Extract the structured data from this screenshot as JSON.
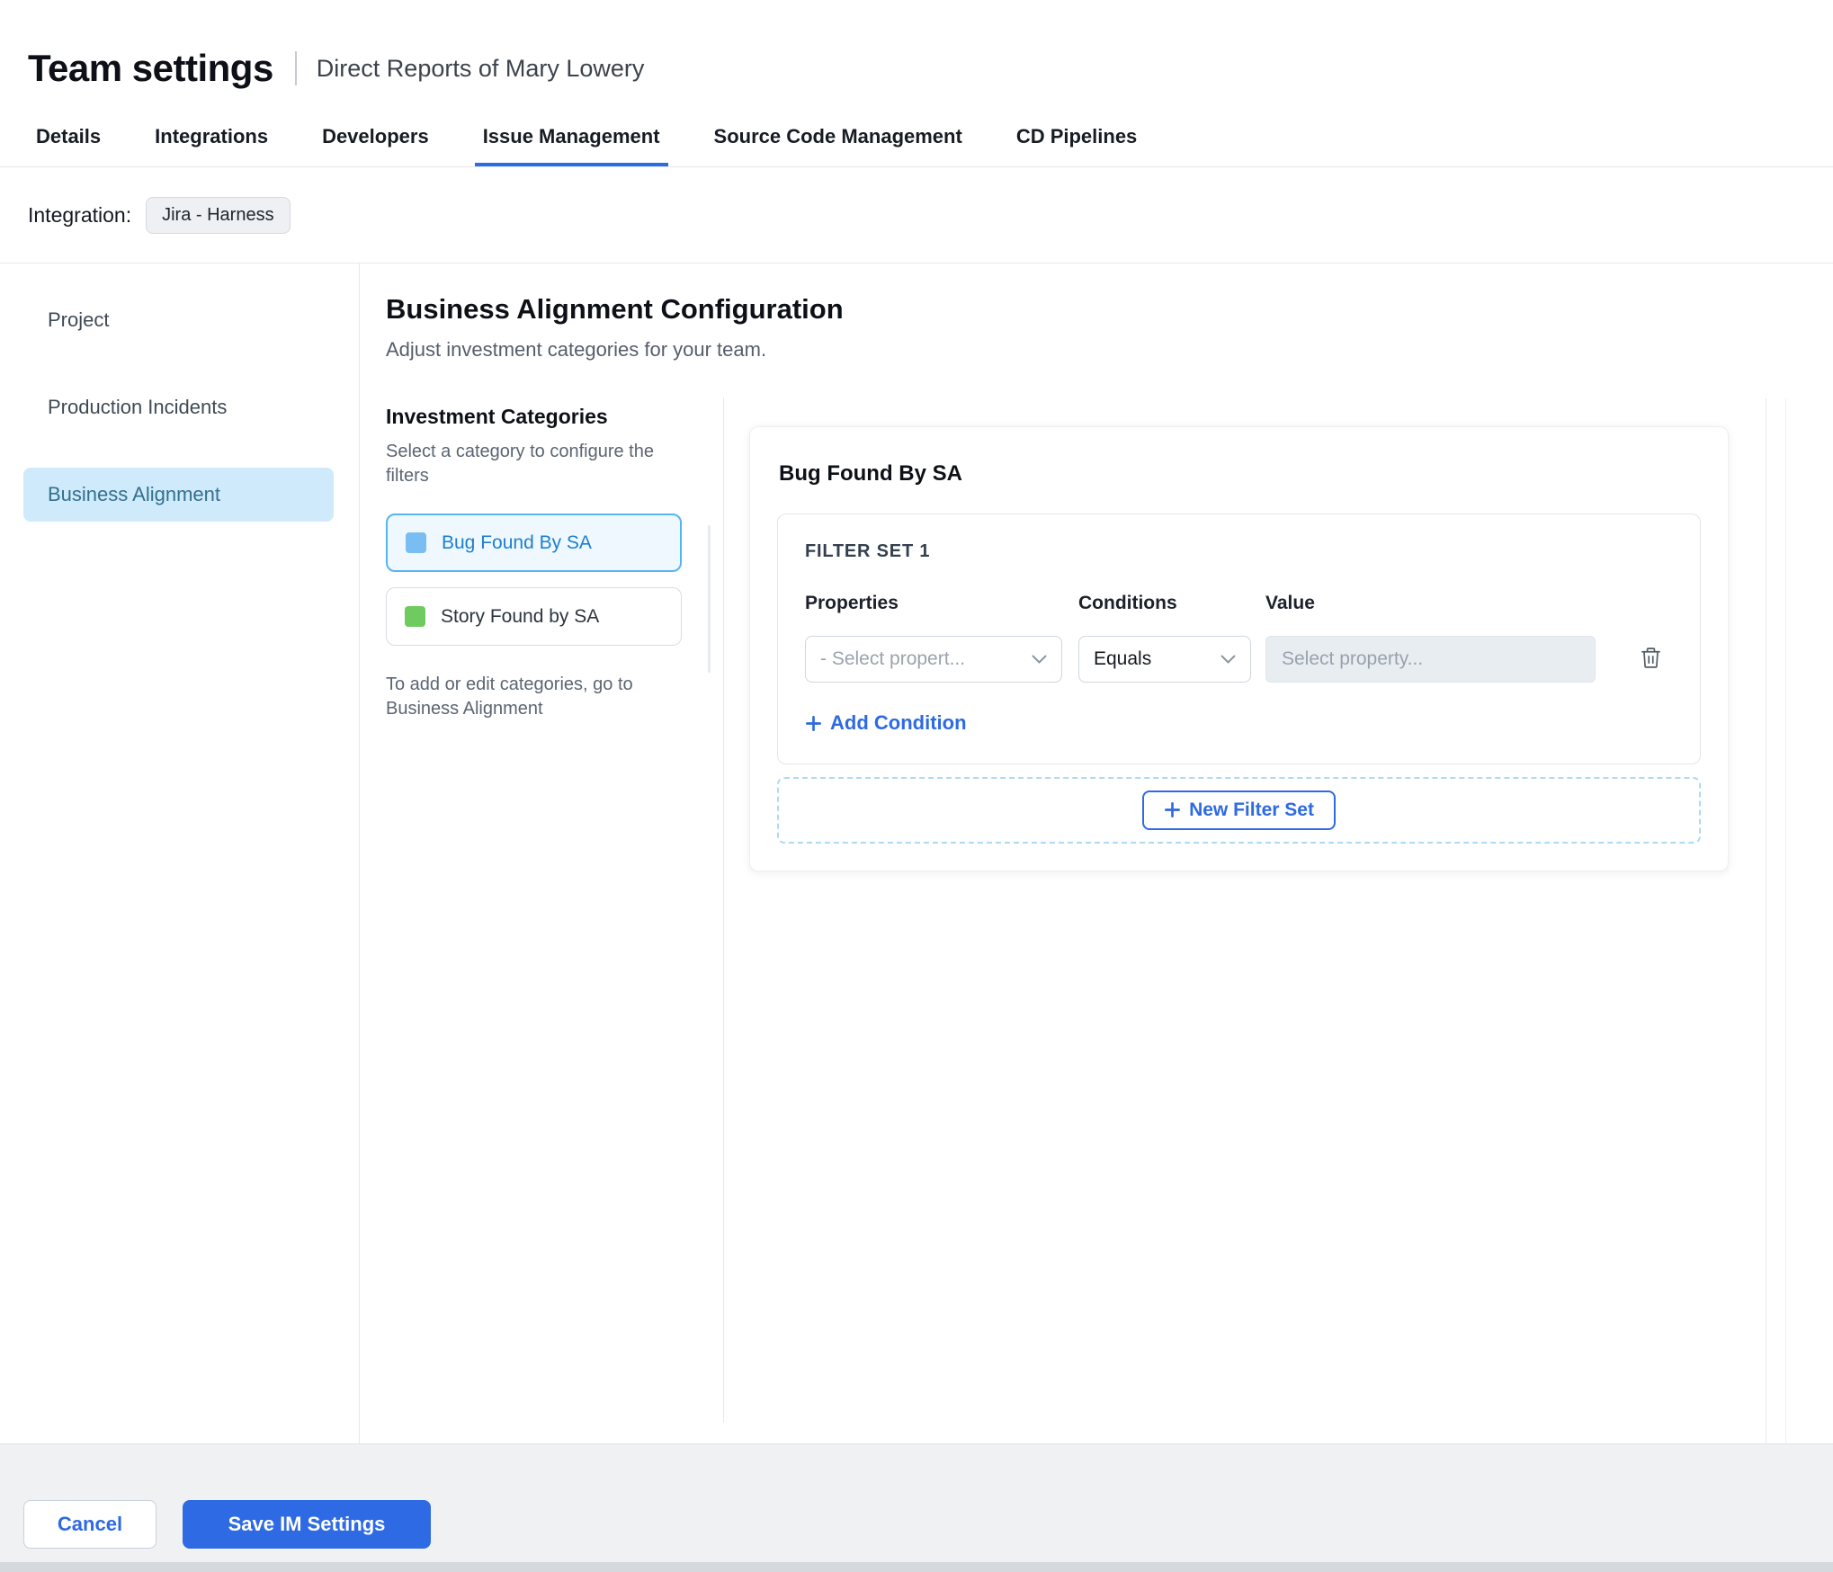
{
  "header": {
    "title": "Team settings",
    "subtitle": "Direct Reports of Mary Lowery"
  },
  "tabs": [
    {
      "label": "Details"
    },
    {
      "label": "Integrations"
    },
    {
      "label": "Developers"
    },
    {
      "label": "Issue Management",
      "active": true
    },
    {
      "label": "Source Code Management"
    },
    {
      "label": "CD Pipelines"
    }
  ],
  "integration": {
    "label": "Integration:",
    "chip": "Jira - Harness"
  },
  "sidebar": {
    "items": [
      {
        "label": "Project"
      },
      {
        "label": "Production Incidents"
      },
      {
        "label": "Business Alignment",
        "active": true
      }
    ]
  },
  "main": {
    "title": "Business Alignment Configuration",
    "subtitle": "Adjust investment categories for your team.",
    "categories": {
      "title": "Investment Categories",
      "hint": "Select a category to configure the filters",
      "items": [
        {
          "label": "Bug Found By SA",
          "color": "#79bdf2",
          "selected": true
        },
        {
          "label": "Story Found by SA",
          "color": "#6fca5f",
          "selected": false
        }
      ],
      "footnote": "To add or edit categories, go to Business Alignment"
    },
    "panel": {
      "title": "Bug Found By SA",
      "filter_set": {
        "title": "FILTER SET 1",
        "columns": [
          "Properties",
          "Conditions",
          "Value"
        ],
        "property_placeholder": "- Select propert...",
        "condition_value": "Equals",
        "value_placeholder": "Select property...",
        "add_condition_label": "Add Condition"
      },
      "new_filter_set_label": "New Filter Set"
    }
  },
  "footer": {
    "cancel_label": "Cancel",
    "save_label": "Save IM Settings"
  },
  "icons": {
    "trash": "trash-icon",
    "chevron": "chevron-down-icon",
    "plus": "plus-icon"
  },
  "colors": {
    "accent_blue": "#2d6ae3",
    "category_selected_border": "#54b5ef",
    "category_selected_bg": "#eef8fe",
    "sidebar_selected_bg": "#cfeafa",
    "swatch_blue": "#79bdf2",
    "swatch_green": "#6fca5f",
    "footer_bg": "#eff1f3"
  }
}
